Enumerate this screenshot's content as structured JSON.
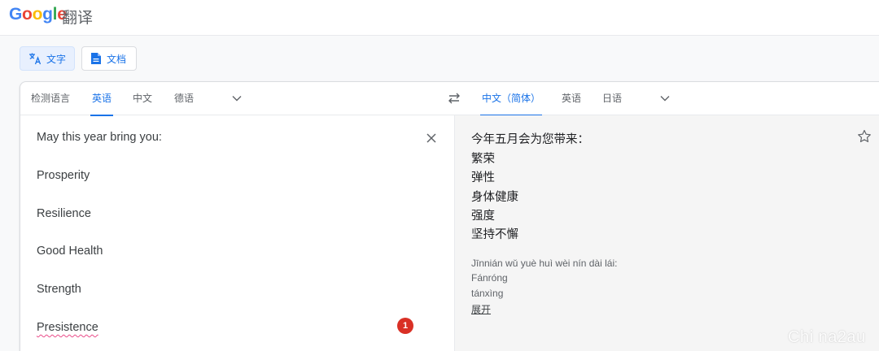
{
  "header": {
    "logo_letters": [
      {
        "ch": "G",
        "color": "#4285F4"
      },
      {
        "ch": "o",
        "color": "#EA4335"
      },
      {
        "ch": "o",
        "color": "#FBBC05"
      },
      {
        "ch": "g",
        "color": "#4285F4"
      },
      {
        "ch": "l",
        "color": "#34A853"
      },
      {
        "ch": "e",
        "color": "#EA4335"
      }
    ],
    "app_name": "翻译"
  },
  "modes": {
    "text_label": "文字",
    "docs_label": "文档",
    "text_icon": "translate-icon",
    "docs_icon": "document-icon"
  },
  "source_langs": {
    "detect": "检测语言",
    "english": "英语",
    "chinese": "中文",
    "german": "德语",
    "selected": "英语"
  },
  "target_langs": {
    "chinese_simplified": "中文（简体）",
    "english": "英语",
    "japanese": "日语",
    "selected": "中文（简体）"
  },
  "source_text": {
    "lines": [
      "May this year bring you:",
      "Prosperity",
      "Resilience",
      "Good Health",
      "Strength",
      "Presistence"
    ],
    "misspelled_word": "Presistence",
    "error_count": "1"
  },
  "translation": {
    "lines": [
      "今年五月会为您带来：",
      "繁荣",
      "弹性",
      "身体健康",
      "强度",
      "坚持不懈"
    ],
    "pinyin": [
      "Jīnnián wǔ yuè huì wèi nín dài lái:",
      "Fánróng",
      "tánxìng"
    ],
    "expand_label": "展开"
  },
  "watermark": "Chi na2au",
  "colors": {
    "accent": "#1a73e8",
    "error_badge": "#d93025",
    "target_bg": "#f5f5f5"
  }
}
